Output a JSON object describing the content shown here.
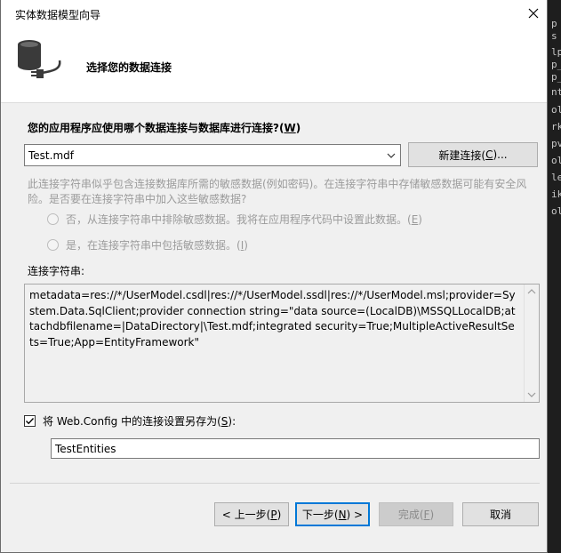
{
  "window": {
    "title": "实体数据模型向导"
  },
  "header": {
    "step_title": "选择您的数据连接"
  },
  "question": {
    "text_before": "您的应用程序应使用哪个数据连接与数据库进行连接?(",
    "accel": "W",
    "text_after": ")"
  },
  "connection_combo": {
    "value": "Test.mdf"
  },
  "new_connection_button": {
    "text_before": "新建连接(",
    "accel": "C",
    "text_after": ")..."
  },
  "sensitive": {
    "description": "此连接字符串似乎包含连接数据库所需的敏感数据(例如密码)。在连接字符串中存储敏感数据可能有安全风险。是否要在连接字符串中加入这些敏感数据?",
    "option_no": {
      "text_before": "否，从连接字符串中排除敏感数据。我将在应用程序代码中设置此数据。(",
      "accel": "E",
      "text_after": ")"
    },
    "option_yes": {
      "text_before": "是，在连接字符串中包括敏感数据。(",
      "accel": "I",
      "text_after": ")"
    }
  },
  "connection_string": {
    "label": "连接字符串:",
    "value": "metadata=res://*/UserModel.csdl|res://*/UserModel.ssdl|res://*/UserModel.msl;provider=System.Data.SqlClient;provider connection string=\"data source=(LocalDB)\\MSSQLLocalDB;attachdbfilename=|DataDirectory|\\Test.mdf;integrated security=True;MultipleActiveResultSets=True;App=EntityFramework\""
  },
  "save_setting": {
    "checked": true,
    "text_before": "将 Web.Config 中的连接设置另存为(",
    "accel": "S",
    "text_after": "):",
    "entity_name": "TestEntities"
  },
  "buttons": {
    "prev": {
      "text_before": "< 上一步(",
      "accel": "P",
      "text_after": ")"
    },
    "next": {
      "text_before": "下一步(",
      "accel": "N",
      "text_after": ") >"
    },
    "finish": {
      "text_before": "完成(",
      "accel": "F",
      "text_after": ")"
    },
    "cancel": {
      "label": "取消"
    }
  },
  "background": {
    "fragments": [
      "p",
      "s",
      "lp",
      "p_",
      "p_",
      "nt",
      "ol",
      "rk",
      "pv",
      "oli",
      "le",
      "ik",
      "ol"
    ]
  },
  "colors": {
    "focus_border": "#0078d7",
    "disabled_text": "#9b9b9b"
  }
}
